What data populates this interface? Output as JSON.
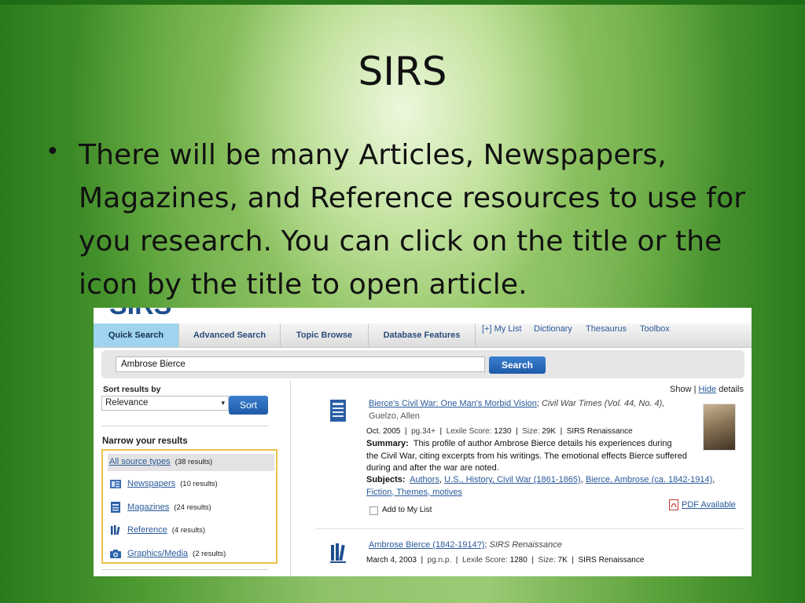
{
  "slide": {
    "title": "SIRS",
    "bullet": "There will be many Articles, Newspapers, Magazines, and Reference resources to use for you research.  You can click on the title or the icon by the title to open article."
  },
  "app": {
    "logo_peek": "SIRS",
    "tabs": [
      "Quick Search",
      "Advanced Search",
      "Topic Browse",
      "Database Features"
    ],
    "top_links": [
      "[+] My List",
      "Dictionary",
      "Thesaurus",
      "Toolbox"
    ],
    "search": {
      "value": "Ambrose Bierce",
      "button": "Search"
    },
    "sort": {
      "label": "Sort results by",
      "selected": "Relevance",
      "button": "Sort"
    },
    "narrow": {
      "label": "Narrow your results",
      "facets": [
        {
          "name": "All source types",
          "count": "(38 results)",
          "icon": "none"
        },
        {
          "name": "Newspapers",
          "count": "(10 results)",
          "icon": "newspaper-icon"
        },
        {
          "name": "Magazines",
          "count": "(24 results)",
          "icon": "magazine-icon"
        },
        {
          "name": "Reference",
          "count": "(4 results)",
          "icon": "reference-books-icon"
        },
        {
          "name": "Graphics/Media",
          "count": "(2 results)",
          "icon": "camera-icon"
        }
      ]
    },
    "show_hide": {
      "show": "Show",
      "sep": "|",
      "hide": "Hide",
      "details": "details"
    },
    "results": [
      {
        "title": "Bierce's Civil War: One Man's Morbid Vision",
        "source": "Civil War Times (Vol. 44, No. 4),",
        "author": "Guelzo, Allen",
        "meta": {
          "date": "Oct. 2005",
          "pages": "pg.34+",
          "lexile_label": "Lexile Score:",
          "lexile": "1230",
          "size_label": "Size:",
          "size": "29K",
          "collection": "SIRS Renaissance"
        },
        "summary_label": "Summary:",
        "summary_lines": [
          "This profile of author Ambrose Bierce details his experiences during",
          "the Civil War, citing excerpts from his writings. The emotional effects Bierce suffered",
          "during and after the war are noted."
        ],
        "subjects_label": "Subjects:",
        "subjects": [
          "Authors",
          "U.S., History, Civil War (1861-1865)",
          "Bierce, Ambrose (ca. 1842-1914)",
          "Fiction, Themes, motives"
        ],
        "add_to_list": "Add to My List",
        "pdf": "PDF Available",
        "icon": "magazine-icon"
      },
      {
        "title": "Ambrose Bierce (1842-1914?)",
        "source": "SIRS Renaissance",
        "meta": {
          "date": "March 4, 2003",
          "pages": "pg.n.p.",
          "lexile_label": "Lexile Score:",
          "lexile": "1280",
          "size_label": "Size:",
          "size": "7K",
          "collection": "SIRS Renaissance"
        },
        "icon": "reference-books-icon"
      }
    ]
  },
  "colors": {
    "slide_green": "#2f7a1f",
    "tab_active": "#9fd3ef",
    "button_blue": "#1e5aa8",
    "link_blue": "#2a5a9a",
    "facet_border": "#f1c04a"
  }
}
